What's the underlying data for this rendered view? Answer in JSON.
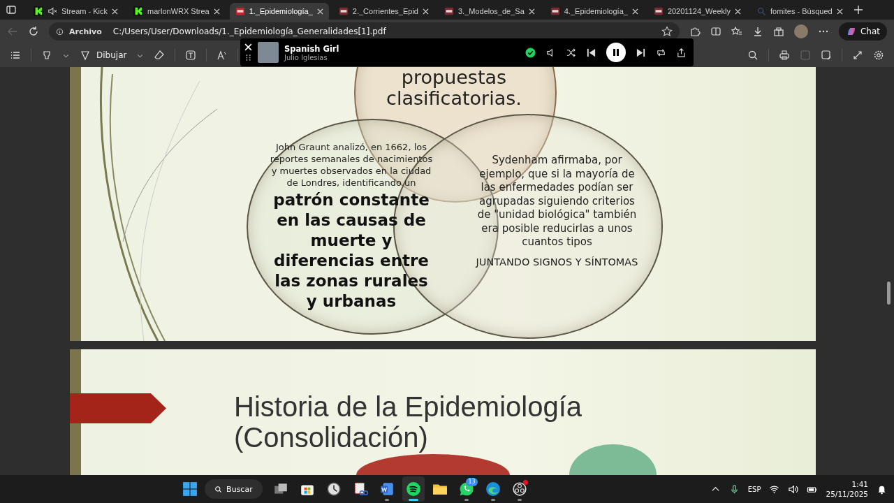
{
  "browser": {
    "tabs": [
      {
        "label": "Stream - Kick",
        "kind": "kick",
        "muted": true,
        "selected": false
      },
      {
        "label": "marlonWRX Strea",
        "kind": "kick",
        "muted": false,
        "selected": false
      },
      {
        "label": "1._Epidemiología_",
        "kind": "pdf",
        "muted": false,
        "selected": true
      },
      {
        "label": "2._Corrientes_Epid",
        "kind": "pdf",
        "muted": false,
        "selected": false
      },
      {
        "label": "3._Modelos_de_Sa",
        "kind": "pdf",
        "muted": false,
        "selected": false
      },
      {
        "label": "4._Epidemiología_",
        "kind": "pdf",
        "muted": false,
        "selected": false
      },
      {
        "label": "20201124_Weekly",
        "kind": "pdf",
        "muted": false,
        "selected": false
      },
      {
        "label": "fomites - Búsqued",
        "kind": "search",
        "muted": false,
        "selected": false
      }
    ],
    "address": {
      "scheme": "Archivo",
      "url": "C:/Users/User/Downloads/1._Epidemiología_Generalidades[1].pdf"
    },
    "chat_button": "Chat"
  },
  "pdf_toolbar": {
    "draw_label": "Dibujar"
  },
  "media_player": {
    "title": "Spanish Girl",
    "artist": "Julio Iglesias",
    "playing": true,
    "liked": true
  },
  "slides": [
    {
      "kind": "venn",
      "top_text": "propuestas clasificatorias.",
      "left_text": "John Graunt analizó, en 1662, los reportes semanales de nacimientos y muertes observados en la ciudad de Londres, identificando un",
      "left_emphasis": "patrón constante en las causas de muerte y diferencias entre las zonas rurales y urbanas",
      "right_text": "Sydenham afirmaba, por ejemplo, que si la mayoría de las enfermedades podían ser agrupadas siguiendo criterios de \"unidad biológica\" también era posible reducirlas a unos cuantos tipos",
      "right_caption": "JUNTANDO SIGNOS Y SÍNTOMAS"
    },
    {
      "kind": "title",
      "title": "Historia de la Epidemiología (Consolidación)"
    }
  ],
  "taskbar": {
    "search_label": "Buscar",
    "apps": [
      {
        "kind": "taskview",
        "active": false,
        "running": false
      },
      {
        "kind": "store",
        "active": false,
        "running": false
      },
      {
        "kind": "clock",
        "active": false,
        "running": false
      },
      {
        "kind": "snip",
        "active": false,
        "running": false
      },
      {
        "kind": "word",
        "active": false,
        "running": true
      },
      {
        "kind": "music",
        "active": true,
        "running": true
      },
      {
        "kind": "folder",
        "active": false,
        "running": false
      },
      {
        "kind": "chat",
        "active": false,
        "running": true,
        "badge": "13"
      },
      {
        "kind": "browser",
        "active": false,
        "running": true
      },
      {
        "kind": "record",
        "active": false,
        "running": true
      }
    ],
    "language": "ESP",
    "time": "1:41",
    "date": "25/11/2025"
  }
}
